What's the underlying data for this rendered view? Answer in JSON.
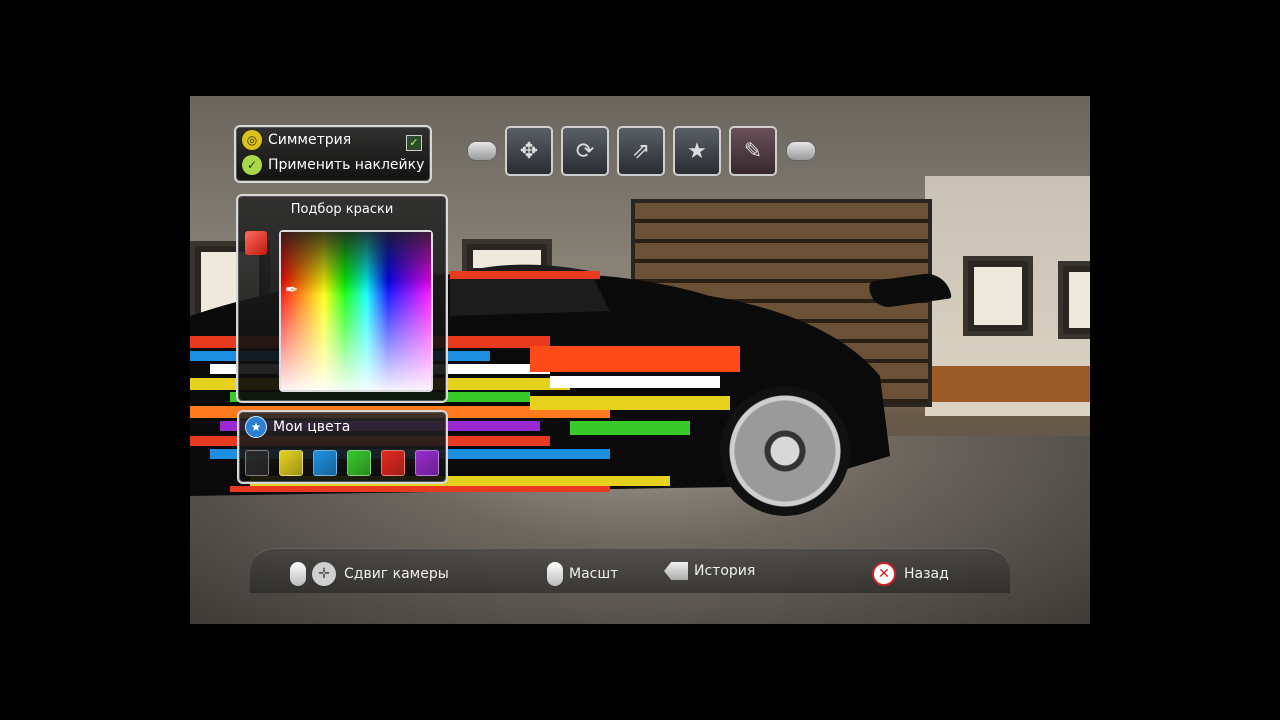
{
  "top_panel": {
    "symmetry_label": "Симметрия",
    "symmetry_checked": true,
    "apply_decal_label": "Применить наклейку"
  },
  "toolbar": {
    "tools": [
      {
        "name": "move-tool",
        "icon": "move-arrows-icon",
        "glyph": "✥"
      },
      {
        "name": "rotate-tool",
        "icon": "rotate-square-icon",
        "glyph": "⟳"
      },
      {
        "name": "scale-tool",
        "icon": "scale-square-icon",
        "glyph": "⇗"
      },
      {
        "name": "stencil-tool",
        "icon": "star-stencil-icon",
        "glyph": "★"
      },
      {
        "name": "paint-pick-tool",
        "icon": "eyedropper-icon",
        "glyph": "✎"
      }
    ],
    "active_index": 4
  },
  "color_picker": {
    "title": "Подбор краски",
    "selected_color": "#e5281e"
  },
  "my_colors": {
    "title": "Мои цвета",
    "swatches": [
      "#2a2a2a",
      "#e6d21e",
      "#1e8fe0",
      "#38c92a",
      "#e5281e",
      "#9a2ad0"
    ]
  },
  "bottom_bar": {
    "camera_label": "Сдвиг камеры",
    "zoom_label": "Масшт",
    "history_label": "История",
    "back_label": "Назад"
  }
}
